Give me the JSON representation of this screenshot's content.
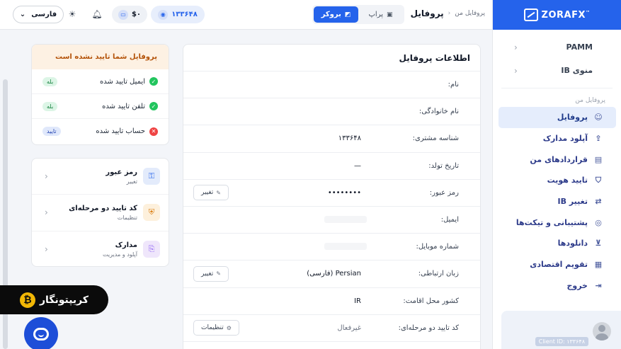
{
  "sidebar": {
    "brand": "ZORAFX",
    "brand_tm": "™",
    "groups": [
      {
        "label": "PAMM",
        "chevron": "‹"
      },
      {
        "label": "منوی IB",
        "chevron": "‹"
      }
    ],
    "section_label": "پروفایل من",
    "items": [
      {
        "label": "پروفایل",
        "icon": "user-circle-icon",
        "glyph": "☺"
      },
      {
        "label": "آپلود مدارک",
        "icon": "file-upload-icon",
        "glyph": "⇪"
      },
      {
        "label": "قراردادهای من",
        "icon": "contract-icon",
        "glyph": "▤"
      },
      {
        "label": "تایید هویت",
        "icon": "shield-check-icon",
        "glyph": "⛉"
      },
      {
        "label": "تغییر IB",
        "icon": "swap-icon",
        "glyph": "⇄"
      },
      {
        "label": "پشتیبانی و تیکت‌ها",
        "icon": "support-icon",
        "glyph": "◎"
      },
      {
        "label": "دانلودها",
        "icon": "download-icon",
        "glyph": "⊻"
      },
      {
        "label": "تقویم اقتصادی",
        "icon": "calendar-icon",
        "glyph": "▦"
      },
      {
        "label": "خروج",
        "icon": "logout-icon",
        "glyph": "⇥"
      }
    ],
    "client_id": "Client ID: ۱۳۳۶۴۸"
  },
  "header": {
    "breadcrumb_parent": "پروفایل من",
    "breadcrumb_sep": "‹",
    "breadcrumb_current": "پروفایل",
    "account_toggle": {
      "broker": "بروکر",
      "prop": "پراپ",
      "selected": "بروکر"
    },
    "account_id": "۱۳۳۶۴۸",
    "balance": "$۰",
    "language": "فارسی",
    "language_chevron": "⌄"
  },
  "profile": {
    "title": "اطلاعات پروفایل",
    "rows": [
      {
        "label": "نام:",
        "value": ""
      },
      {
        "label": "نام خانوادگی:",
        "value": ""
      },
      {
        "label": "شناسه مشتری:",
        "value": "۱۳۳۶۴۸"
      },
      {
        "label": "تاریخ تولد:",
        "value": "—"
      },
      {
        "label": "رمز عبور:",
        "value": "••••••••",
        "button": "تغییر"
      },
      {
        "label": "ایمیل:",
        "value": ""
      },
      {
        "label": "شماره موبایل:",
        "value": ""
      },
      {
        "label": "زبان ارتباطی:",
        "value": "Persian (فارسی)",
        "button": "تغییر"
      },
      {
        "label": "کشور محل اقامت:",
        "value": "IR"
      },
      {
        "label": "کد تایید دو مرحله‌ای:",
        "value": "غیرفعال",
        "button": "تنظیمات"
      }
    ]
  },
  "verification": {
    "header": "پروفایل شما تایید نشده است",
    "items": [
      {
        "label": "ایمیل تایید شده",
        "status": "ok",
        "badge": "بله"
      },
      {
        "label": "تلفن تایید شده",
        "status": "ok",
        "badge": "بله"
      },
      {
        "label": "حساب تایید شده",
        "status": "no",
        "badge": "تایید"
      }
    ]
  },
  "security": {
    "items": [
      {
        "title": "رمز عبور",
        "subtitle": "تغییر",
        "icon": "key-icon",
        "glyph": "⚿"
      },
      {
        "title": "کد تایید دو مرحله‌ای",
        "subtitle": "تنظیمات",
        "icon": "shield-icon",
        "glyph": "⛨"
      },
      {
        "title": "مدارک",
        "subtitle": "آپلود و مدیریت",
        "icon": "document-icon",
        "glyph": "⎘"
      }
    ]
  },
  "floating": {
    "brand": "کریپتونگار",
    "brand_mark": "₿"
  },
  "colors": {
    "primary": "#2563eb",
    "success": "#22c55e",
    "danger": "#ef4444",
    "warning_bg": "#fdf1e3",
    "warning_text": "#b45309"
  }
}
